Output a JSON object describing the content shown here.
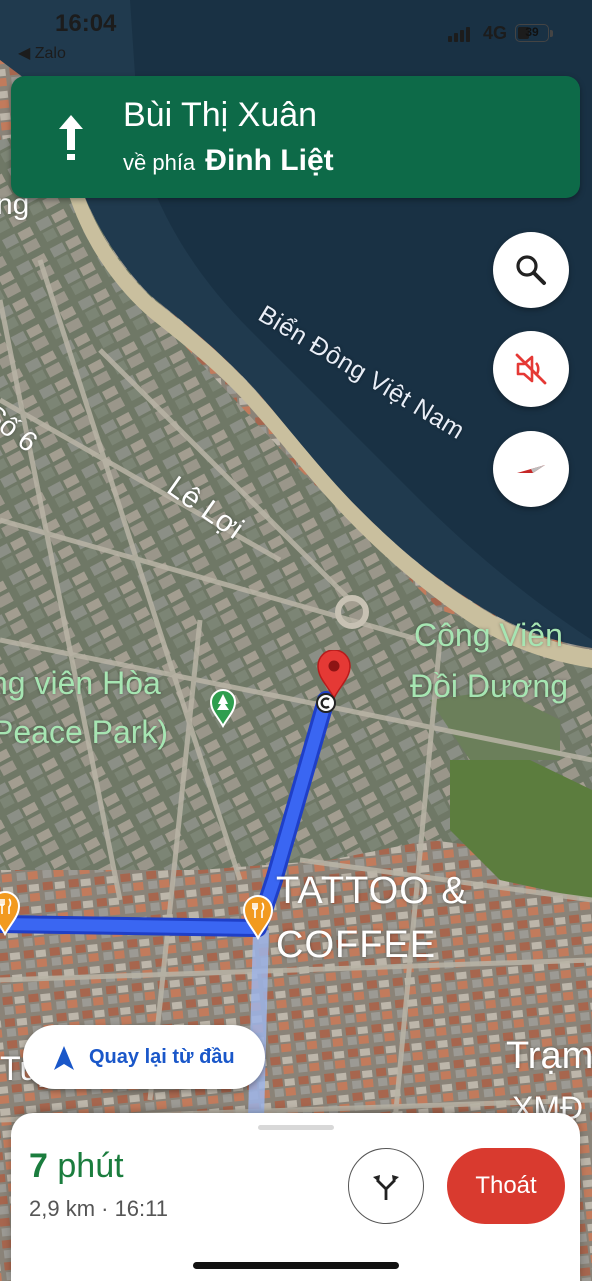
{
  "status_bar": {
    "time": "16:04",
    "back_app": "◀ Zalo",
    "network": "4G",
    "battery": "39"
  },
  "banner": {
    "street": "Bùi Thị Xuân",
    "toward_prefix": "về phía",
    "toward_street": "Đinh Liệt",
    "direction_icon": "arrow-up-icon",
    "color": "#0d6a48"
  },
  "map_labels": {
    "sea": "Biển Đông Việt Nam",
    "street_le_loi": "Lê Lợi",
    "street_so6": "Số 6",
    "street_top_left": "ng",
    "street_bottom": "Tuyên Quang",
    "park1_line1": "ng viên Hòa",
    "park1_line2": "Peace Park)",
    "park2_line1": "Công Viên",
    "park2_line2": "Đồi Dương",
    "poi_line1": "TATTOO &",
    "poi_line2": "COFFEE",
    "cut1": "Trạm",
    "cut2": "XMĐ"
  },
  "controls": {
    "search_icon": "search-icon",
    "mute_icon": "volume-off-icon",
    "compass_icon": "compass-icon",
    "recenter_label": "Quay lại từ đầu"
  },
  "trip": {
    "eta_value": "7",
    "eta_unit": "phút",
    "details": "2,9 km · 16:11",
    "exit_label": "Thoát",
    "alt_routes_icon": "alternate-routes-icon",
    "eta_color": "#1b7d3e",
    "exit_color": "#d93a2f"
  },
  "route_color": "#3a66f2"
}
